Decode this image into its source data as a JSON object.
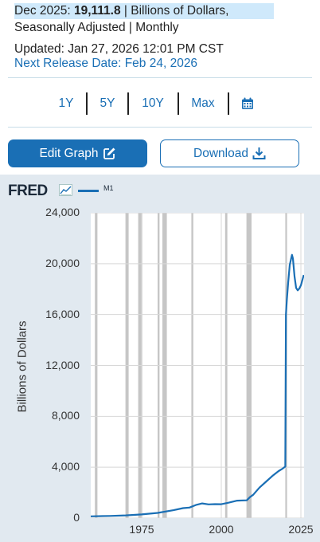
{
  "header": {
    "line1_prefix": "Dec 2025: ",
    "line1_value": "19,111.8",
    "line1_suffix": " | Billions of Dollars,",
    "line2": "Seasonally Adjusted | Monthly",
    "updated": "Updated: Jan 27, 2026 12:01 PM CST",
    "next_release": "Next Release Date: Feb 24, 2026"
  },
  "ranges": [
    "1Y",
    "5Y",
    "10Y",
    "Max"
  ],
  "buttons": {
    "edit": "Edit Graph",
    "download": "Download"
  },
  "brand": {
    "name": "FRED",
    "icon": "trend-line-icon",
    "accent": "#1a6fb5"
  },
  "legend": {
    "series_name": "M1"
  },
  "icons": {
    "calendar": "calendar-icon",
    "edit": "pencil-edit-icon",
    "download": "download-tray-icon"
  },
  "chart_data": {
    "type": "line",
    "ylabel": "Billions of Dollars",
    "xlabel": "",
    "ylim": [
      0,
      24000
    ],
    "xlim": [
      1959,
      2026
    ],
    "yticks": [
      "0",
      "4,000",
      "8,000",
      "12,000",
      "16,000",
      "20,000",
      "24,000"
    ],
    "xticks": [
      "1975",
      "2000",
      "2025"
    ],
    "recession_bands": [
      [
        1960.3,
        1961.1
      ],
      [
        1969.9,
        1970.9
      ],
      [
        1973.9,
        1975.2
      ],
      [
        1980.0,
        1980.6
      ],
      [
        1981.5,
        1982.9
      ],
      [
        1990.6,
        1991.2
      ],
      [
        2001.2,
        2001.9
      ],
      [
        2007.9,
        2009.5
      ],
      [
        2020.1,
        2020.4
      ]
    ],
    "series": [
      {
        "name": "M1",
        "color": "#1a6fb5",
        "x": [
          1959,
          1965,
          1970,
          1975,
          1980,
          1985,
          1988,
          1990,
          1992,
          1994,
          1996,
          1998,
          2000,
          2002,
          2005,
          2008,
          2009,
          2010,
          2012,
          2014,
          2016,
          2018,
          2019,
          2020.1,
          2020.3,
          2020.6,
          2021,
          2021.5,
          2022.2,
          2022.5,
          2023,
          2023.5,
          2024,
          2024.5,
          2025,
          2025.9
        ],
        "y": [
          140,
          170,
          215,
          290,
          410,
          620,
          785,
          825,
          1025,
          1150,
          1080,
          1095,
          1090,
          1200,
          1370,
          1400,
          1650,
          1830,
          2400,
          2850,
          3300,
          3700,
          3850,
          4050,
          16000,
          17200,
          18500,
          19900,
          20700,
          20400,
          19000,
          18100,
          17900,
          18050,
          18300,
          19111.8
        ]
      }
    ]
  }
}
